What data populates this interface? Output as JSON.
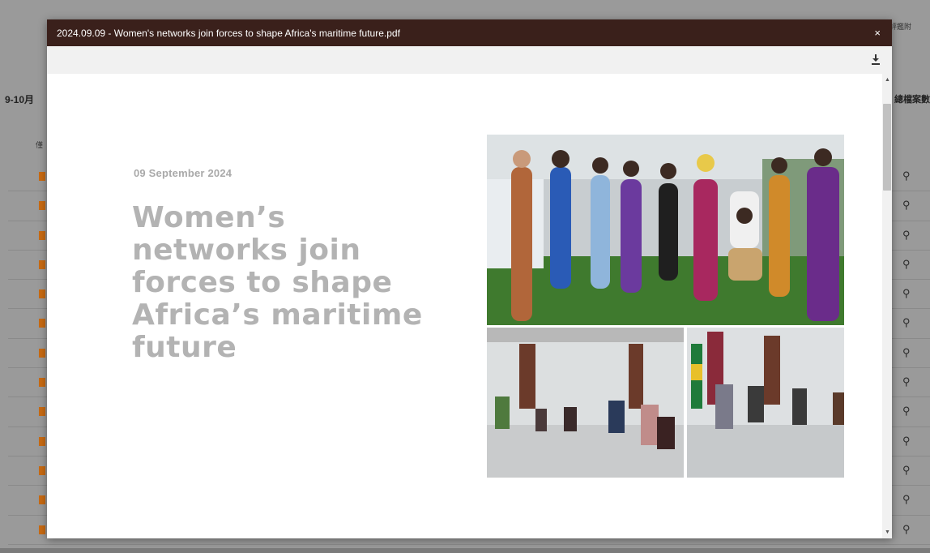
{
  "background": {
    "left_label": "9-10月",
    "right_label": "總檔案數",
    "top_right_text": "評鑑附",
    "column_header_fragment": "僅",
    "row_count": 13
  },
  "modal": {
    "title": "2024.09.09 - Women's networks join forces to shape Africa's maritime future.pdf",
    "close_symbol": "×"
  },
  "document": {
    "date": "09 September 2024",
    "headline_lines": [
      "Women’s",
      "networks join",
      "forces to shape",
      "Africa’s maritime",
      "future"
    ]
  },
  "colors": {
    "header_bg": "#3a201b",
    "headline": "#b3b3b3",
    "file_icon": "#c86a12"
  },
  "icons": {
    "download": "download-icon",
    "search": "search-icon",
    "file": "file-icon"
  }
}
